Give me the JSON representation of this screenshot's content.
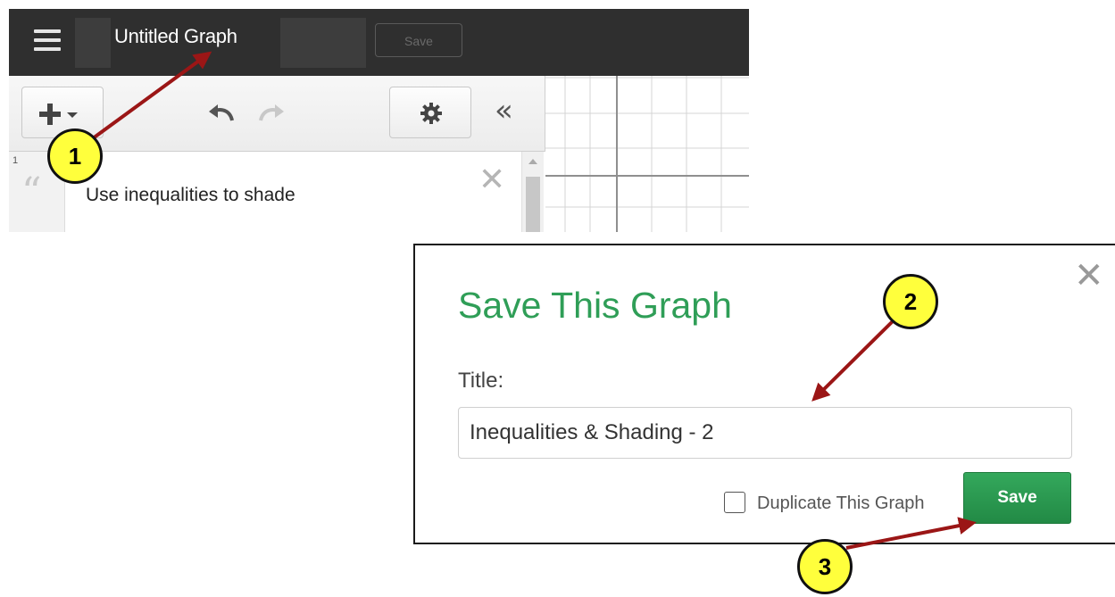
{
  "app": {
    "graph_title": "Untitled Graph",
    "save_label": "Save",
    "expression": {
      "index": "1",
      "text": "Use inequalities to shade"
    }
  },
  "dialog": {
    "heading": "Save This Graph",
    "title_label": "Title:",
    "title_value": "Inequalities & Shading - 2",
    "duplicate_label": "Duplicate This Graph",
    "duplicate_checked": false,
    "save_label": "Save",
    "accent_color": "#2f9e57"
  },
  "callouts": [
    "1",
    "2",
    "3"
  ],
  "annotation_colors": {
    "arrow": "#9b1616",
    "callout_fill": "#ffff3c"
  }
}
